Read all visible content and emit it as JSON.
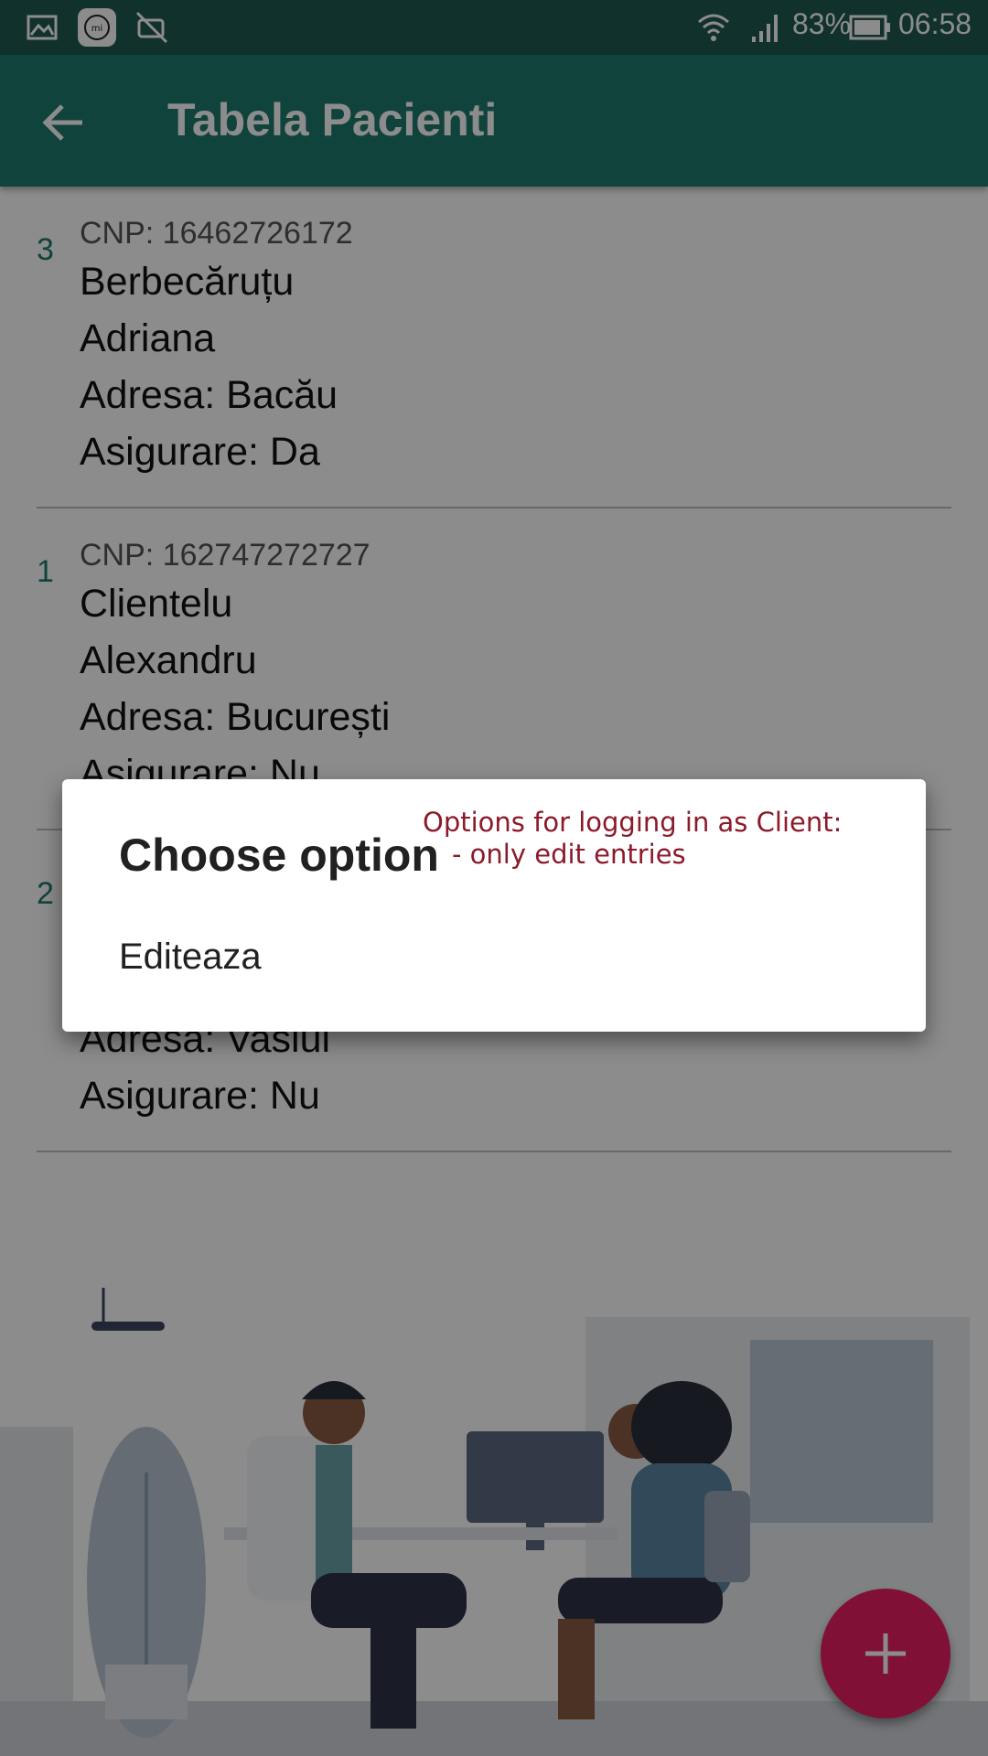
{
  "status_bar": {
    "battery": "83%",
    "time": "06:58",
    "icons": [
      "gallery-icon",
      "mi-icon",
      "sync-off-icon",
      "wifi-icon",
      "signal-icon",
      "battery-icon"
    ]
  },
  "app_bar": {
    "title": "Tabela Pacienti",
    "back_icon": "arrow-back-icon"
  },
  "patients": [
    {
      "id": "3",
      "cnp": "CNP: 16462726172",
      "last_name": "Berbecăruțu",
      "first_name": "Adriana",
      "address": "Adresa: Bacău",
      "insurance": "Asigurare: Da"
    },
    {
      "id": "1",
      "cnp": "CNP: 162747272727",
      "last_name": "Clientelu",
      "first_name": "Alexandru",
      "address": "Adresa: București",
      "insurance": "Asigurare: Nu"
    },
    {
      "id": "2",
      "cnp": "",
      "last_name": "",
      "first_name": "",
      "address": "Adresa: Vaslui",
      "insurance": "Asigurare: Nu"
    }
  ],
  "dialog": {
    "title": "Choose option",
    "options": [
      "Editeaza"
    ]
  },
  "annotation": {
    "line1": "Options for logging in as Client:",
    "line2": "- only edit entries"
  },
  "fab": {
    "label": "+",
    "icon": "plus-icon"
  },
  "colors": {
    "primary": "#1f7a6f",
    "status_bar": "#1f5a53",
    "accent": "#e91e63",
    "annotation": "#8b1a2b"
  }
}
